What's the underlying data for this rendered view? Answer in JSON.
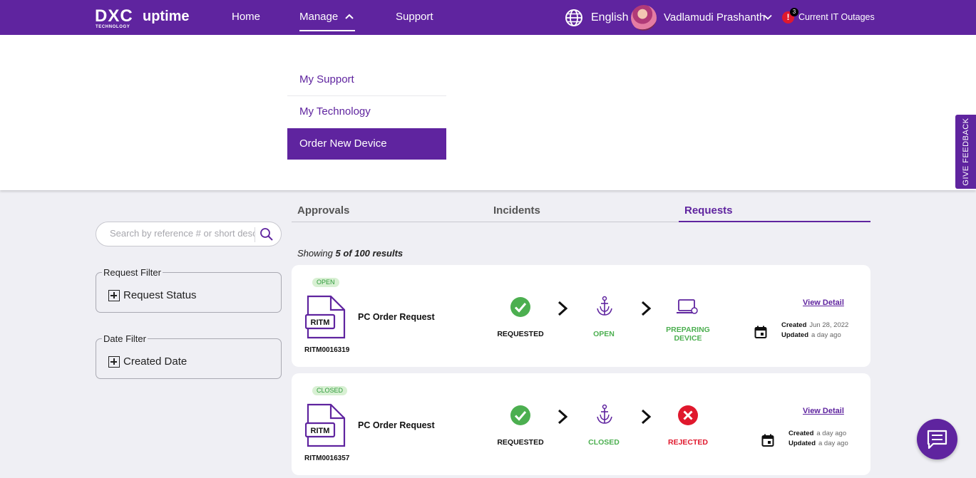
{
  "header": {
    "logo_mark": "DXC",
    "logo_subtitle": "TECHNOLOGY",
    "app_name": "uptime",
    "nav": [
      {
        "label": "Home"
      },
      {
        "label": "Manage"
      },
      {
        "label": "Support"
      }
    ],
    "language": "English",
    "user_name": "Vadlamudi Prashanth",
    "outage_count": "3",
    "outage_label": "Current IT Outages"
  },
  "manage_menu": {
    "items": [
      {
        "label": "My Support"
      },
      {
        "label": "My Technology"
      },
      {
        "label": "Order New Device"
      }
    ]
  },
  "feedback_label": "GIVE FEEDBACK",
  "tabs": [
    {
      "label": "Approvals"
    },
    {
      "label": "Incidents"
    },
    {
      "label": "Requests"
    }
  ],
  "filters": {
    "search_placeholder": "Search by reference # or short desc",
    "request_filter_legend": "Request Filter",
    "request_status_label": "Request Status",
    "date_filter_legend": "Date Filter",
    "created_date_label": "Created Date"
  },
  "results": {
    "prefix": "Showing",
    "count": "5 of 100 results"
  },
  "cards": [
    {
      "status": "OPEN",
      "icon_text": "RITM",
      "number": "RITM0016319",
      "title": "PC Order Request",
      "steps": [
        "REQUESTED",
        "OPEN",
        "PREPARING DEVICE"
      ],
      "view_detail": "View Detail",
      "created_label": "Created",
      "created_value": "Jun 28, 2022",
      "updated_label": "Updated",
      "updated_value": "a day ago"
    },
    {
      "status": "CLOSED",
      "icon_text": "RITM",
      "number": "RITM0016357",
      "title": "PC Order Request",
      "steps": [
        "REQUESTED",
        "CLOSED",
        "REJECTED"
      ],
      "view_detail": "View Detail",
      "created_label": "Created",
      "created_value": "a day ago",
      "updated_label": "Updated",
      "updated_value": "a day ago"
    }
  ],
  "colors": {
    "brand": "#5f249f",
    "success": "#4caf50",
    "danger": "#e0182d",
    "page_bg": "#efeff4"
  },
  "icons": {
    "globe": "globe-icon",
    "chat": "chat-icon",
    "search": "search-icon",
    "calendar": "calendar-icon"
  }
}
